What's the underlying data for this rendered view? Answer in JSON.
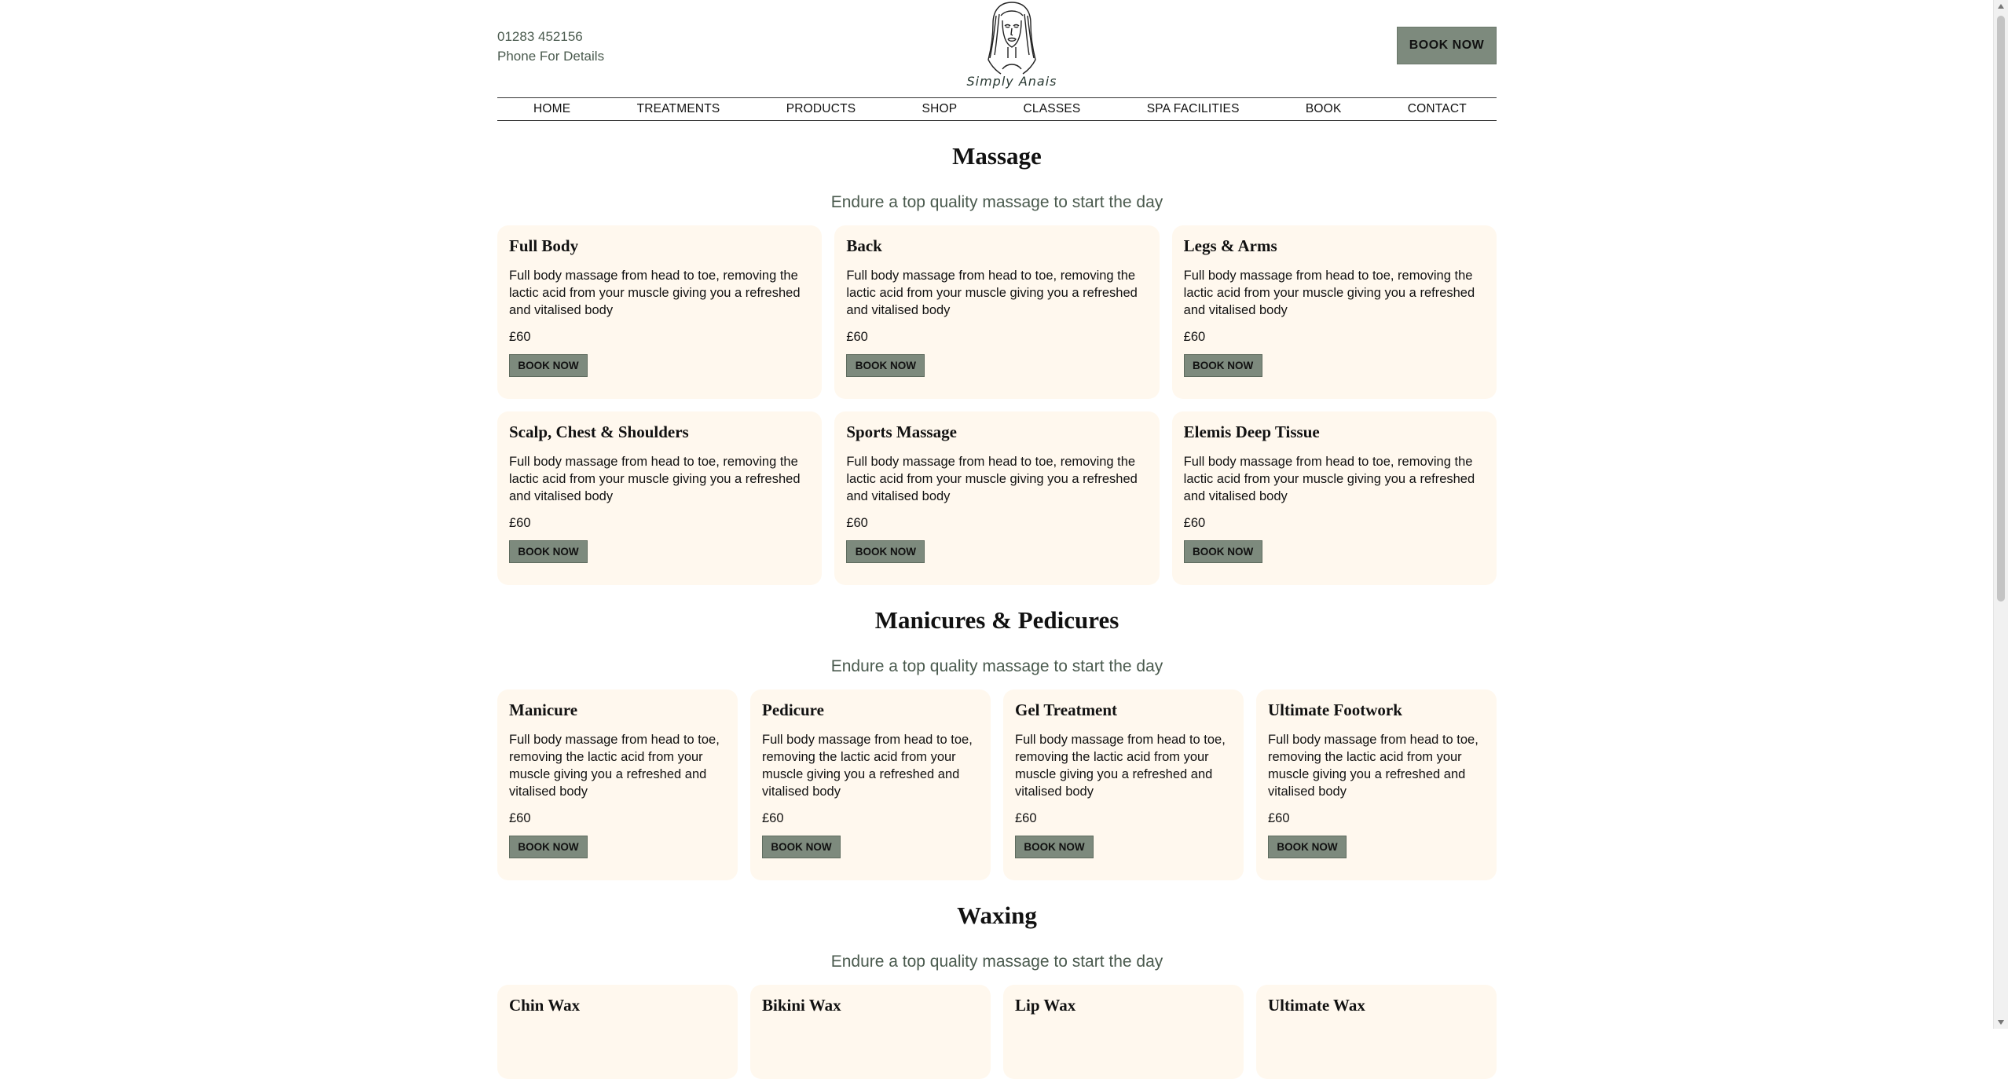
{
  "header": {
    "phone_number": "01283 452156",
    "phone_note": "Phone For Details",
    "logo_text": "Simply Anais",
    "book_label": "BOOK NOW"
  },
  "nav": {
    "items": [
      "HOME",
      "TREATMENTS",
      "PRODUCTS",
      "SHOP",
      "CLASSES",
      "SPA FACILITIES",
      "BOOK",
      "CONTACT"
    ]
  },
  "sections": [
    {
      "title": "Massage",
      "subtitle": "Endure a top quality massage to start the day",
      "cards": [
        {
          "title": "Full Body",
          "desc": "Full body massage from head to toe, removing the lactic acid from your muscle giving you a refreshed and vitalised body",
          "price": "£60",
          "button": "BOOK NOW"
        },
        {
          "title": "Back",
          "desc": "Full body massage from head to toe, removing the lactic acid from your muscle giving you a refreshed and vitalised body",
          "price": "£60",
          "button": "BOOK NOW"
        },
        {
          "title": "Legs & Arms",
          "desc": "Full body massage from head to toe, removing the lactic acid from your muscle giving you a refreshed and vitalised body",
          "price": "£60",
          "button": "BOOK NOW"
        },
        {
          "title": "Scalp, Chest & Shoulders",
          "desc": "Full body massage from head to toe, removing the lactic acid from your muscle giving you a refreshed and vitalised body",
          "price": "£60",
          "button": "BOOK NOW"
        },
        {
          "title": "Sports Massage",
          "desc": "Full body massage from head to toe, removing the lactic acid from your muscle giving you a refreshed and vitalised body",
          "price": "£60",
          "button": "BOOK NOW"
        },
        {
          "title": "Elemis Deep Tissue",
          "desc": "Full body massage from head to toe, removing the lactic acid from your muscle giving you a refreshed and vitalised body",
          "price": "£60",
          "button": "BOOK NOW"
        }
      ]
    },
    {
      "title": "Manicures & Pedicures",
      "subtitle": "Endure a top quality massage to start the day",
      "cards": [
        {
          "title": "Manicure",
          "desc": "Full body massage from head to toe, removing the lactic acid from your muscle giving you a refreshed and vitalised body",
          "price": "£60",
          "button": "BOOK NOW"
        },
        {
          "title": "Pedicure",
          "desc": "Full body massage from head to toe, removing the lactic acid from your muscle giving you a refreshed and vitalised body",
          "price": "£60",
          "button": "BOOK NOW"
        },
        {
          "title": "Gel Treatment",
          "desc": "Full body massage from head to toe, removing the lactic acid from your muscle giving you a refreshed and vitalised body",
          "price": "£60",
          "button": "BOOK NOW"
        },
        {
          "title": "Ultimate Footwork",
          "desc": "Full body massage from head to toe, removing the lactic acid from your muscle giving you a refreshed and vitalised body",
          "price": "£60",
          "button": "BOOK NOW"
        }
      ]
    },
    {
      "title": "Waxing",
      "subtitle": "Endure a top quality massage to start the day",
      "cards": [
        {
          "title": "Chin Wax"
        },
        {
          "title": "Bikini Wax"
        },
        {
          "title": "Lip Wax"
        },
        {
          "title": "Ultimate Wax"
        }
      ]
    }
  ],
  "colors": {
    "accent_button": "#7d8a7d",
    "card_background": "#fff8ee",
    "subtitle_text": "#4a5a4e"
  },
  "icons": {
    "logo": "woman-face-line-art"
  }
}
